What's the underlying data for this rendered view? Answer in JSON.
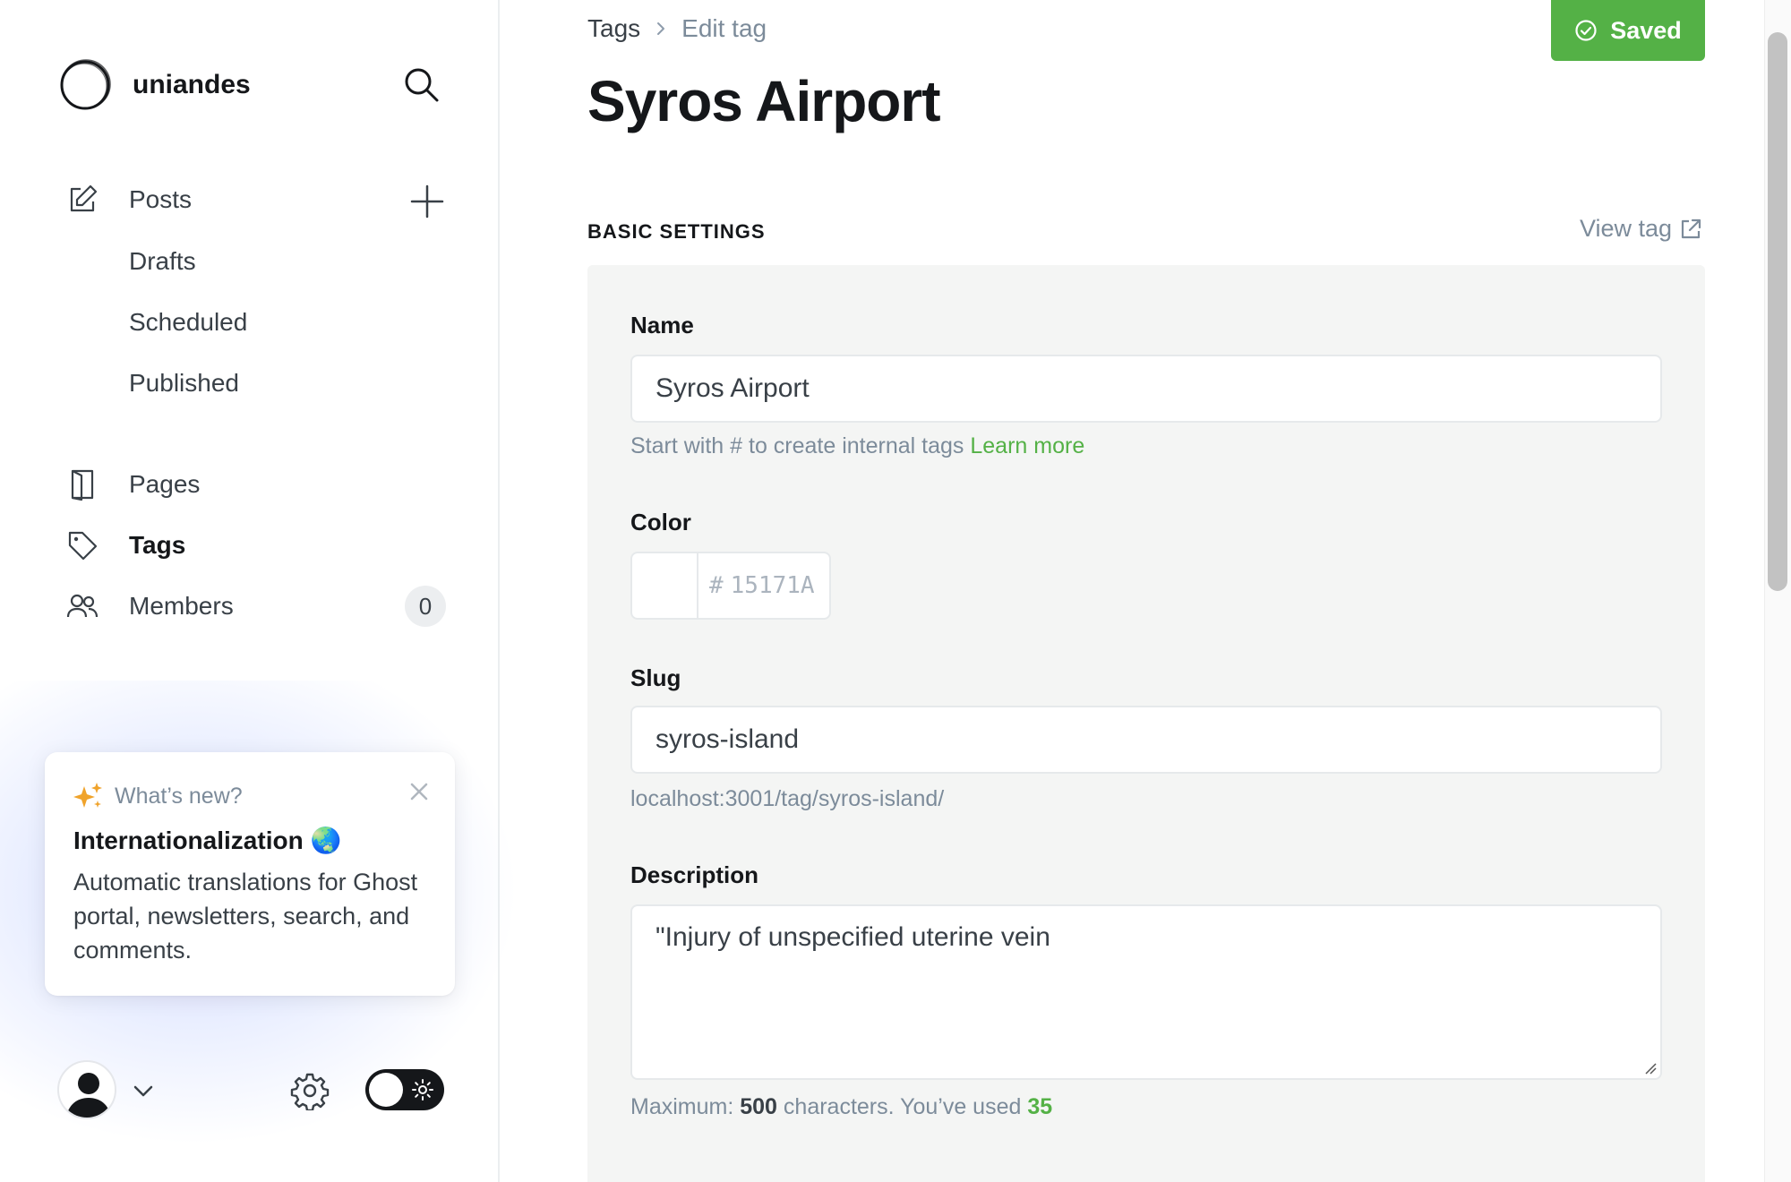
{
  "sidebar": {
    "brand": {
      "name": "uniandes"
    },
    "nav": {
      "posts": "Posts",
      "drafts": "Drafts",
      "scheduled": "Scheduled",
      "published": "Published",
      "pages": "Pages",
      "tags": "Tags",
      "members": "Members",
      "members_count": "0"
    },
    "whats_new": {
      "kicker": "What’s new?",
      "title": "Internationalization 🌏",
      "body": "Automatic translations for Ghost portal, newsletters, search, and comments."
    }
  },
  "header": {
    "breadcrumb_root": "Tags",
    "breadcrumb_current": "Edit tag",
    "title": "Syros Airport",
    "saved_label": "Saved"
  },
  "section": {
    "title": "BASIC SETTINGS",
    "view_tag": "View tag"
  },
  "form": {
    "name_label": "Name",
    "name_value": "Syros Airport",
    "name_hint": "Start with # to create internal tags",
    "name_hint_link": "Learn more",
    "color_label": "Color",
    "color_hash": "#",
    "color_placeholder": "15171A",
    "slug_label": "Slug",
    "slug_value": "syros-island",
    "slug_url": "localhost:3001/tag/syros-island/",
    "description_label": "Description",
    "description_value": "\"Injury of unspecified uterine vein",
    "desc_hint_prefix": "Maximum:",
    "desc_hint_max": "500",
    "desc_hint_middle": "characters. You’ve used",
    "desc_hint_used": "35"
  },
  "colors": {
    "accent_green": "#54b146",
    "text_dark": "#15171a",
    "text_muted": "#7c8b9a"
  }
}
